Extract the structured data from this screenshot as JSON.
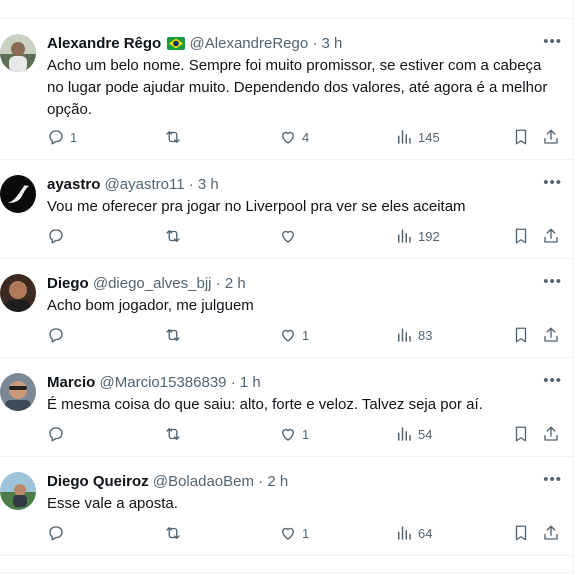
{
  "colors": {
    "text": "#0f1419",
    "muted": "#536471",
    "divider": "#eff3f4"
  },
  "icons": [
    "reply-icon",
    "retweet-icon",
    "like-icon",
    "views-icon",
    "bookmark-icon",
    "share-icon",
    "more-icon"
  ],
  "tweets": [
    {
      "name": "Alexandre Rêgo",
      "handle": "@AlexandreRego",
      "dot": "·",
      "time": "3 h",
      "text": "Acho um belo nome. Sempre foi muito promissor, se estiver com a cabeça no lugar pode ajudar muito. Dependendo dos valores, até agora é a melhor opção.",
      "replies": "1",
      "retweets": "",
      "likes": "4",
      "views": "145"
    },
    {
      "name": "ayastro",
      "handle": "@ayastro11",
      "dot": "·",
      "time": "3 h",
      "text": "Vou me oferecer pra jogar no Liverpool pra ver se eles aceitam",
      "replies": "",
      "retweets": "",
      "likes": "",
      "views": "192"
    },
    {
      "name": "Diego",
      "handle": "@diego_alves_bjj",
      "dot": "·",
      "time": "2 h",
      "text": "Acho bom jogador, me julguem",
      "replies": "",
      "retweets": "",
      "likes": "1",
      "views": "83"
    },
    {
      "name": "Marcio",
      "handle": "@Marcio15386839",
      "dot": "·",
      "time": "1 h",
      "text": "É mesma coisa do que saiu: alto, forte e veloz. Talvez seja por aí.",
      "replies": "",
      "retweets": "",
      "likes": "1",
      "views": "54"
    },
    {
      "name": "Diego Queiroz",
      "handle": "@BoladaoBem",
      "dot": "·",
      "time": "2 h",
      "text": "Esse vale a aposta.",
      "replies": "",
      "retweets": "",
      "likes": "1",
      "views": "64"
    }
  ]
}
